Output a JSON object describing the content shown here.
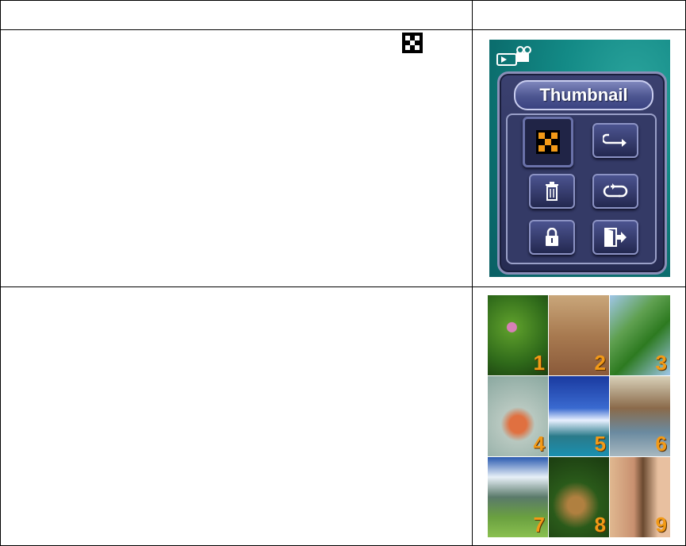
{
  "menu": {
    "title": "Thumbnail",
    "buttons": [
      {
        "icon": "thumbnail-grid-icon",
        "selected": true
      },
      {
        "icon": "return-arrow-icon",
        "selected": false
      },
      {
        "icon": "trash-icon",
        "selected": false
      },
      {
        "icon": "repeat-icon",
        "selected": false
      },
      {
        "icon": "lock-icon",
        "selected": false
      },
      {
        "icon": "exit-door-icon",
        "selected": false
      }
    ]
  },
  "thumbnails": [
    {
      "number": "1"
    },
    {
      "number": "2"
    },
    {
      "number": "3"
    },
    {
      "number": "4"
    },
    {
      "number": "5"
    },
    {
      "number": "6"
    },
    {
      "number": "7"
    },
    {
      "number": "8"
    },
    {
      "number": "9"
    }
  ],
  "colors": {
    "accent": "#f29a17",
    "teal": "#138a86",
    "panel": "#343a66"
  }
}
